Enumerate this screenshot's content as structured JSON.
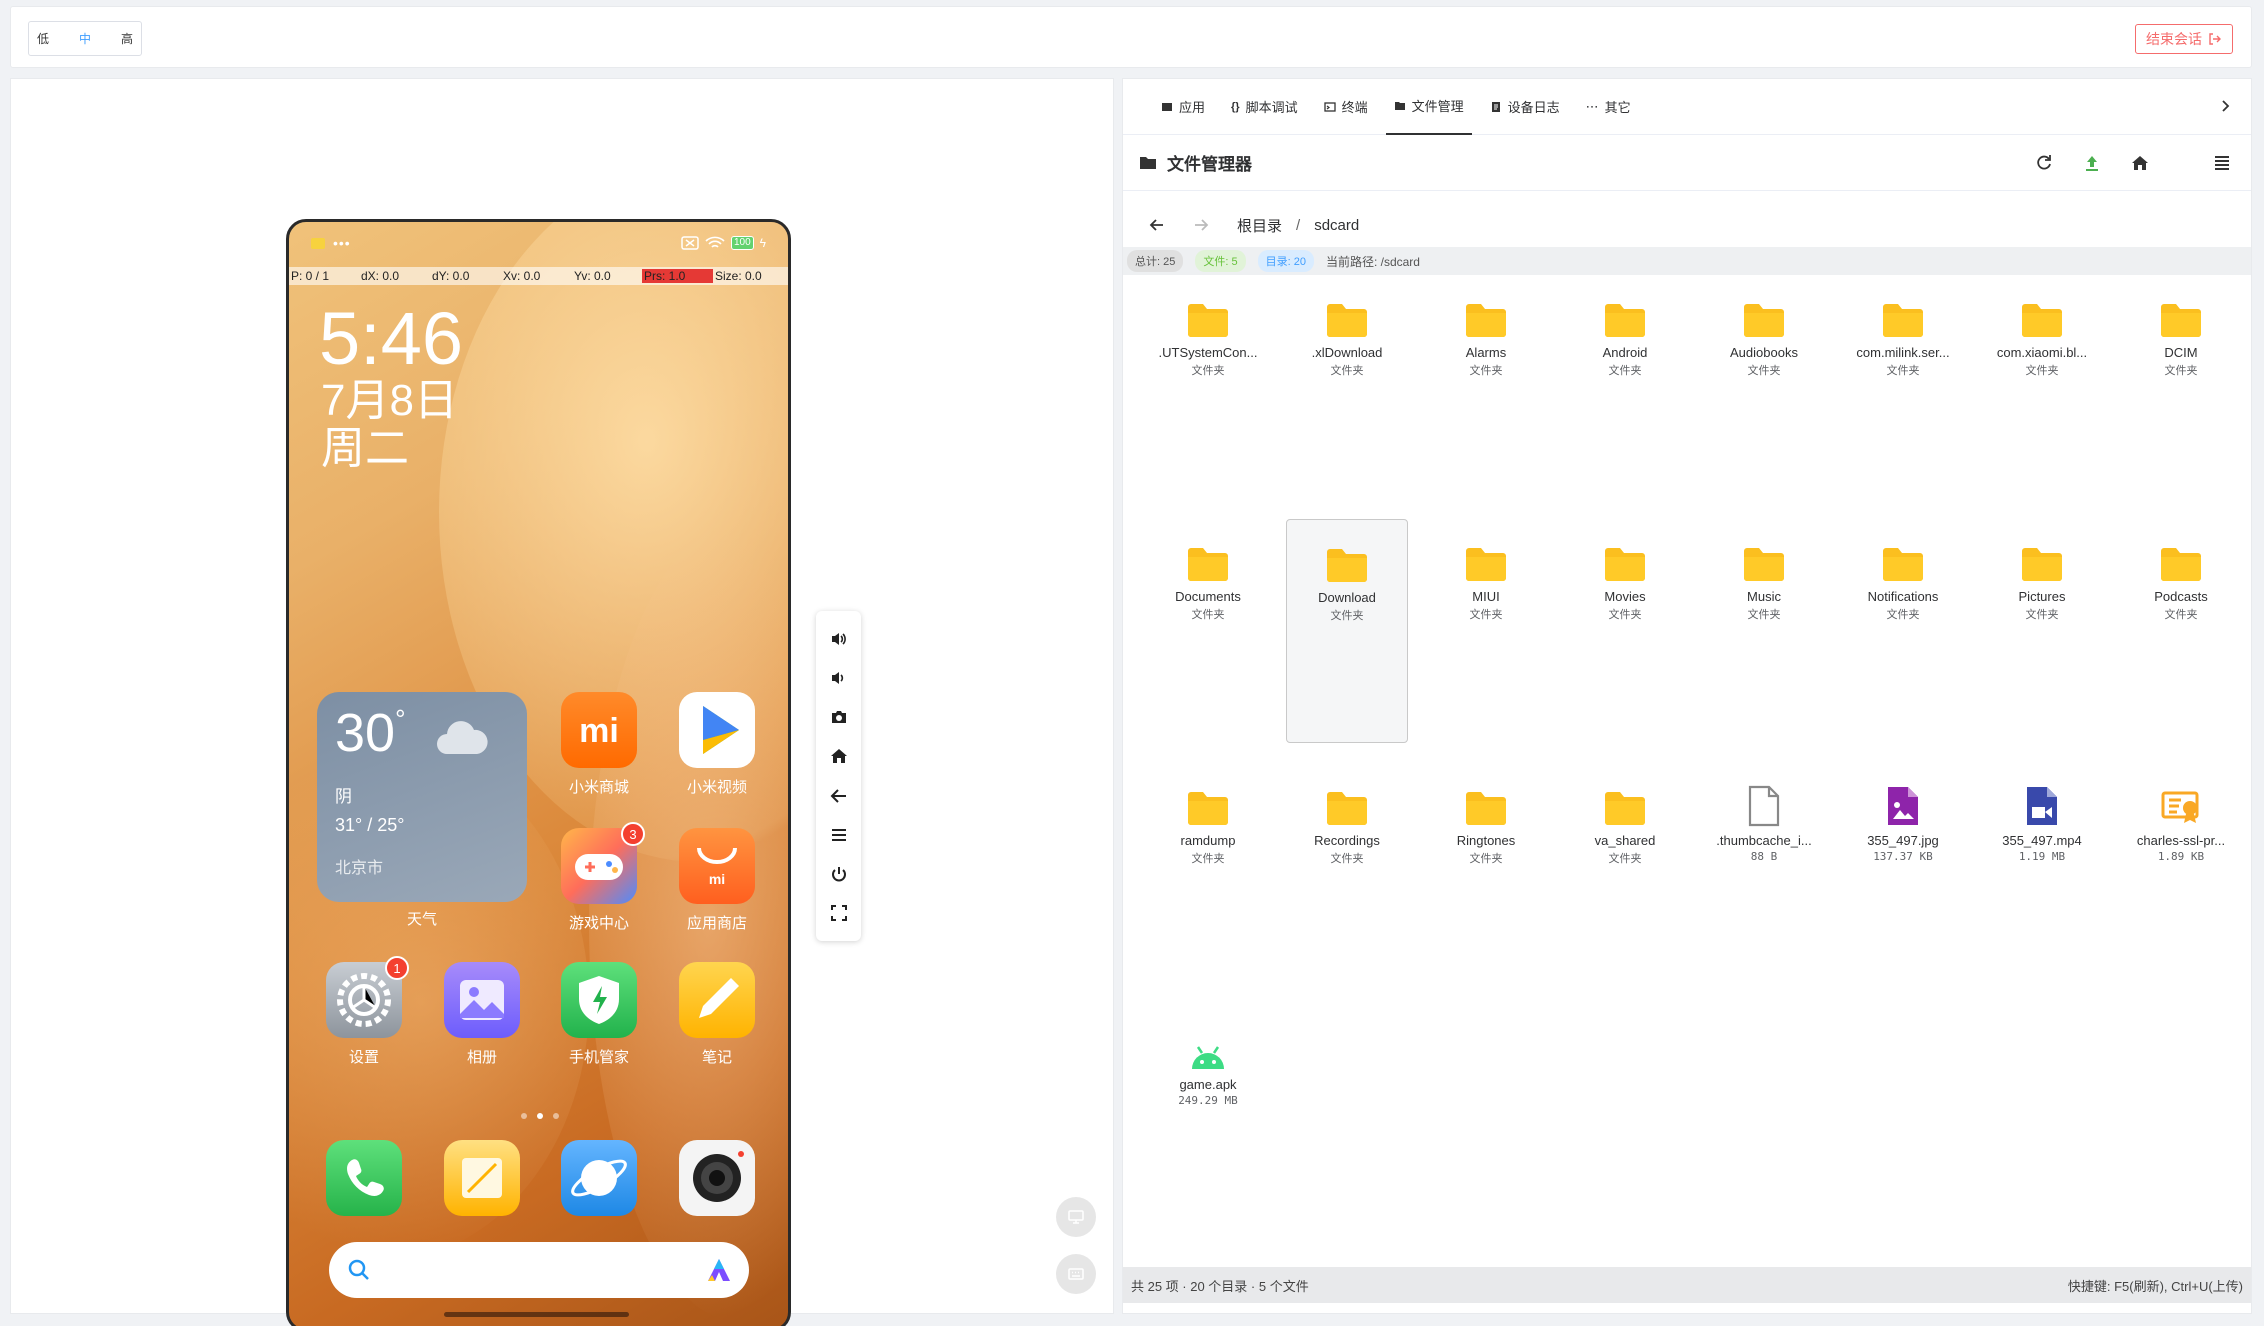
{
  "quality": {
    "low": "低",
    "mid": "中",
    "high": "高"
  },
  "end_session": "结束会话",
  "phone": {
    "debug": {
      "p": "P: 0 / 1",
      "dx": "dX: 0.0",
      "dy": "dY: 0.0",
      "xv": "Xv: 0.0",
      "yv": "Yv: 0.0",
      "prs": "Prs: 1.0",
      "size": "Size: 0.0"
    },
    "battery": "100",
    "time": "5:46",
    "date": "7月8日",
    "weekday": "周二",
    "weather": {
      "temp": "30",
      "unit": "°",
      "cond": "阴",
      "range": "31° / 25°",
      "city": "北京市",
      "label": "天气"
    },
    "apps": {
      "mi_store": "小米商城",
      "mi_video": "小米视频",
      "game_center": "游戏中心",
      "app_store": "应用商店",
      "settings": "设置",
      "gallery": "相册",
      "security": "手机管家",
      "notes": "笔记"
    },
    "badges": {
      "game_center": "3",
      "settings": "1"
    }
  },
  "tabs": {
    "apps": "应用",
    "script": "脚本调试",
    "terminal": "终端",
    "files": "文件管理",
    "logs": "设备日志",
    "more": "其它"
  },
  "fm": {
    "title": "文件管理器",
    "crumb_root": "根目录",
    "crumb_sep": "/",
    "crumb_cur": "sdcard",
    "stats": {
      "total": "总计: 25",
      "files": "文件: 5",
      "dirs": "目录: 20",
      "path": "当前路径: /sdcard"
    },
    "items": [
      {
        "name": ".UTSystemCon...",
        "meta": "文件夹",
        "kind": "folder"
      },
      {
        "name": ".xlDownload",
        "meta": "文件夹",
        "kind": "folder"
      },
      {
        "name": "Alarms",
        "meta": "文件夹",
        "kind": "folder"
      },
      {
        "name": "Android",
        "meta": "文件夹",
        "kind": "folder"
      },
      {
        "name": "Audiobooks",
        "meta": "文件夹",
        "kind": "folder"
      },
      {
        "name": "com.milink.ser...",
        "meta": "文件夹",
        "kind": "folder"
      },
      {
        "name": "com.xiaomi.bl...",
        "meta": "文件夹",
        "kind": "folder"
      },
      {
        "name": "DCIM",
        "meta": "文件夹",
        "kind": "folder"
      },
      {
        "name": "Documents",
        "meta": "文件夹",
        "kind": "folder"
      },
      {
        "name": "Download",
        "meta": "文件夹",
        "kind": "folder",
        "selected": true
      },
      {
        "name": "MIUI",
        "meta": "文件夹",
        "kind": "folder"
      },
      {
        "name": "Movies",
        "meta": "文件夹",
        "kind": "folder"
      },
      {
        "name": "Music",
        "meta": "文件夹",
        "kind": "folder"
      },
      {
        "name": "Notifications",
        "meta": "文件夹",
        "kind": "folder"
      },
      {
        "name": "Pictures",
        "meta": "文件夹",
        "kind": "folder"
      },
      {
        "name": "Podcasts",
        "meta": "文件夹",
        "kind": "folder"
      },
      {
        "name": "ramdump",
        "meta": "文件夹",
        "kind": "folder"
      },
      {
        "name": "Recordings",
        "meta": "文件夹",
        "kind": "folder"
      },
      {
        "name": "Ringtones",
        "meta": "文件夹",
        "kind": "folder"
      },
      {
        "name": "va_shared",
        "meta": "文件夹",
        "kind": "folder"
      },
      {
        "name": ".thumbcache_i...",
        "meta": "88 B",
        "kind": "file"
      },
      {
        "name": "355_497.jpg",
        "meta": "137.37 KB",
        "kind": "image"
      },
      {
        "name": "355_497.mp4",
        "meta": "1.19 MB",
        "kind": "video"
      },
      {
        "name": "charles-ssl-pr...",
        "meta": "1.89 KB",
        "kind": "cert"
      },
      {
        "name": "game.apk",
        "meta": "249.29 MB",
        "kind": "apk"
      }
    ],
    "footer_left": "共 25 项 · 20 个目录 · 5 个文件",
    "footer_right": "快捷键: F5(刷新), Ctrl+U(上传)"
  },
  "colors": {
    "folder": "#fbbf1f",
    "accent": "#409eff",
    "danger": "#f56c6c",
    "image": "#8e24aa",
    "video": "#3949ab",
    "cert": "#f9a825",
    "apk": "#3ddc84"
  }
}
